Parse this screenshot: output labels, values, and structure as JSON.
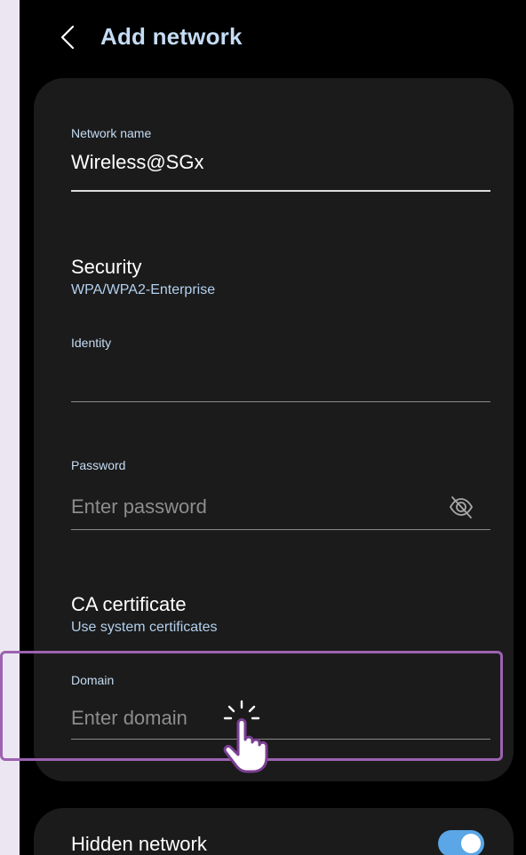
{
  "header": {
    "title": "Add network"
  },
  "network_name": {
    "label": "Network name",
    "value": "Wireless@SGx"
  },
  "security": {
    "title": "Security",
    "value": "WPA/WPA2-Enterprise"
  },
  "identity": {
    "label": "Identity",
    "value": ""
  },
  "password": {
    "label": "Password",
    "placeholder": "Enter password"
  },
  "ca_certificate": {
    "title": "CA certificate",
    "value": "Use system certificates"
  },
  "domain": {
    "label": "Domain",
    "placeholder": "Enter domain"
  },
  "hidden_network": {
    "label": "Hidden network",
    "enabled": true
  },
  "icons": {
    "back": "chevron-left-icon",
    "password_visibility": "eye-off-icon",
    "cursor": "hand-pointer-icon"
  },
  "colors": {
    "accent": "#c5dcf4",
    "subtext": "#b3d0ee",
    "toggle_on": "#5aa6e6",
    "highlight": "#9c62b0",
    "card": "#1b1b1b"
  }
}
